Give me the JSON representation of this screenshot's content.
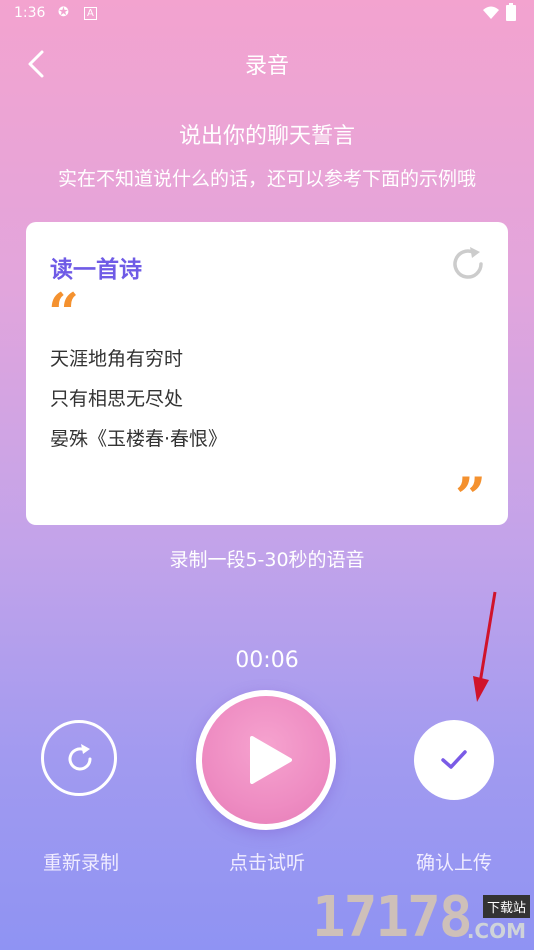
{
  "status_bar": {
    "time": "1:36"
  },
  "header": {
    "title": "录音"
  },
  "prompt": {
    "subtitle": "说出你的聊天誓言",
    "hint": "实在不知道说什么的话，还可以参考下面的示例哦"
  },
  "card": {
    "title": "读一首诗",
    "open_quote": "“",
    "close_quote": "”",
    "lines": [
      "天涯地角有穷时",
      "只有相思无尽处",
      "晏殊《玉楼春·春恨》"
    ]
  },
  "duration_hint": "录制一段5-30秒的语音",
  "timer": "00:06",
  "controls": {
    "rerecord_label": "重新录制",
    "play_label": "点击试听",
    "confirm_label": "确认上传"
  },
  "watermark": {
    "number": "17178",
    "tag": "下载站",
    "suffix": ".COM"
  },
  "colors": {
    "accent": "#6f5be6",
    "quote": "#f4912f",
    "arrow": "#d0132a"
  }
}
